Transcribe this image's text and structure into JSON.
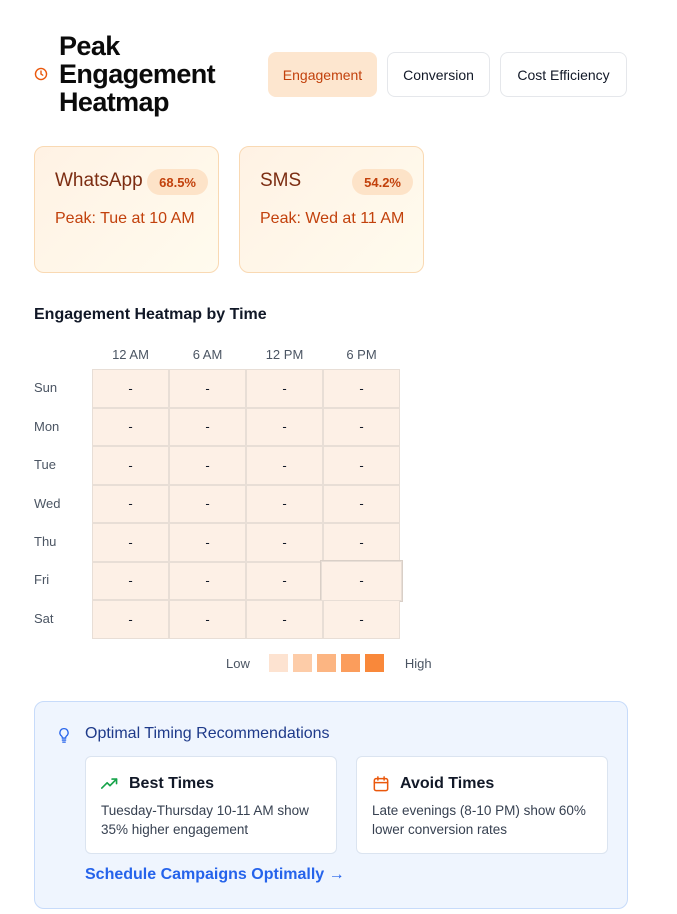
{
  "header": {
    "title": "Peak Engagement Heatmap",
    "icon": "clock-icon"
  },
  "tabs": [
    {
      "label": "Engagement",
      "active": true
    },
    {
      "label": "Conversion",
      "active": false
    },
    {
      "label": "Cost Efficiency",
      "active": false
    }
  ],
  "channels": [
    {
      "name": "WhatsApp",
      "rate": "68.5%",
      "peak": "Peak: Tue at 10 AM"
    },
    {
      "name": "SMS",
      "rate": "54.2%",
      "peak": "Peak: Wed at 11 AM"
    }
  ],
  "heatmap": {
    "title": "Engagement Heatmap by Time",
    "columns": [
      "12 AM",
      "6 AM",
      "12 PM",
      "6 PM"
    ],
    "rows": [
      "Sun",
      "Mon",
      "Tue",
      "Wed",
      "Thu",
      "Fri",
      "Sat"
    ],
    "cell_value": "-",
    "legend": {
      "low": "Low",
      "high": "High",
      "colors": [
        "#fde3d1",
        "#fdcca8",
        "#fcb582",
        "#fb9d5c",
        "#f9883a"
      ]
    }
  },
  "recommendations": {
    "title": "Optimal Timing Recommendations",
    "icon": "lightbulb-icon",
    "best": {
      "icon": "trending-up-icon",
      "heading": "Best Times",
      "body": "Tuesday-Thursday 10-11 AM show 35% higher engagement"
    },
    "avoid": {
      "icon": "calendar-icon",
      "heading": "Avoid Times",
      "body": "Late evenings (8-10 PM) show 60% lower conversion rates"
    },
    "link": "Schedule Campaigns Optimally →"
  },
  "colors": {
    "accent": "#ea580c",
    "accent_light": "#fde6cf",
    "link": "#2563eb"
  }
}
